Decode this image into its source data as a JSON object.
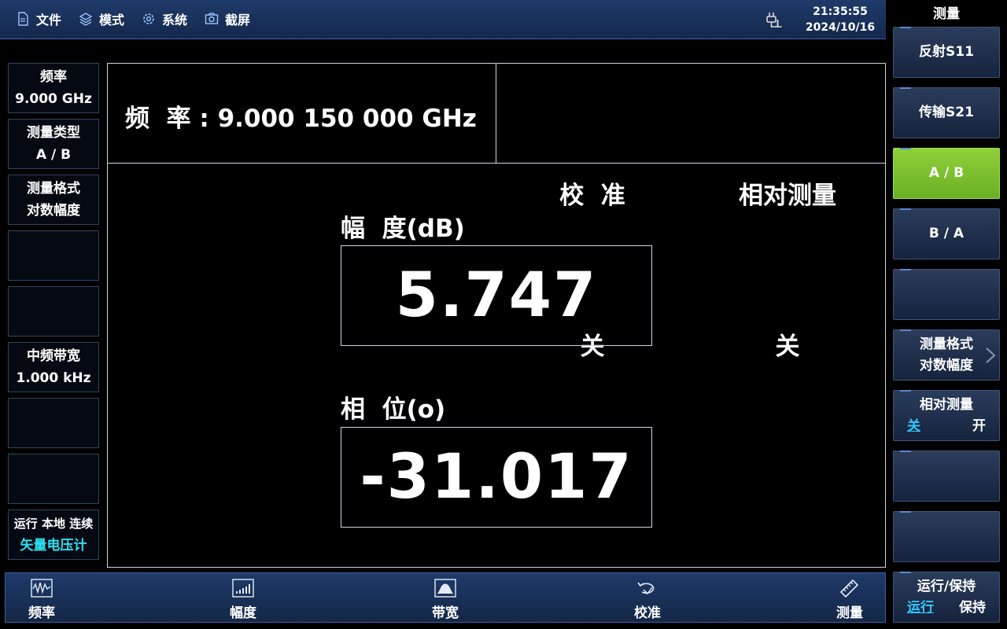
{
  "menu": [
    {
      "label": "文件",
      "icon": "file-icon"
    },
    {
      "label": "模式",
      "icon": "layers-icon"
    },
    {
      "label": "系统",
      "icon": "gear-icon"
    },
    {
      "label": "截屏",
      "icon": "camera-icon"
    }
  ],
  "clock": {
    "time": "21:35:55",
    "date": "2024/10/16"
  },
  "right_panel": {
    "title": "测量",
    "keys": {
      "s11": "反射S11",
      "s21": "传输S21",
      "ab": "A / B",
      "ba": "B / A",
      "format_title": "测量格式",
      "format_value": "对数幅度",
      "rel_title": "相对测量",
      "rel_off": "关",
      "rel_on": "开",
      "run_title": "运行/保持",
      "run_run": "运行",
      "run_hold": "保持"
    }
  },
  "left_panel": {
    "freq_label": "频率",
    "freq_value": "9.000 GHz",
    "type_label": "测量类型",
    "type_value": "A / B",
    "format_label": "测量格式",
    "format_value": "对数幅度",
    "ifbw_label": "中频带宽",
    "ifbw_value": "1.000 kHz",
    "status": "运行 本地 连续",
    "mode": "矢量电压计"
  },
  "main": {
    "frequency": "频  率 : 9.000 150 000 GHz",
    "cal_label": "校  准",
    "cal_value": "关",
    "rel_label": "相对测量",
    "rel_value": "关",
    "amp_label": "幅  度(dB)",
    "amp_value": "5.747",
    "phase_label": "相  位(o)",
    "phase_value": "-31.017"
  },
  "bottom": {
    "freq": "频率",
    "amp": "幅度",
    "bw": "带宽",
    "cal": "校准",
    "meas": "测量"
  },
  "colors": {
    "accent_green": "#7dc22e",
    "highlight_cyan": "#33c7ff",
    "bar_blue": "#1e3a6a"
  }
}
